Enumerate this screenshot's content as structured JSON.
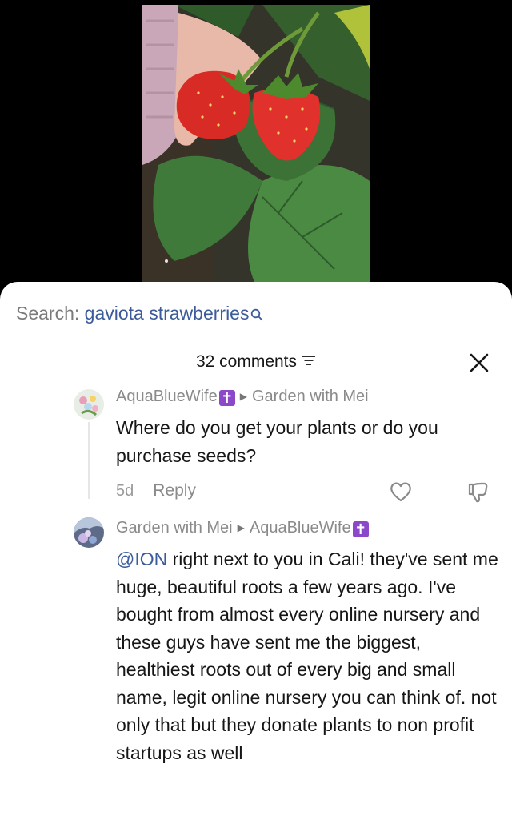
{
  "search": {
    "label": "Search:",
    "query": "gaviota strawberries",
    "icon": "search-icon"
  },
  "comments": {
    "count_label": "32 comments",
    "sort_icon": "sort-icon",
    "close_icon": "close-icon"
  },
  "comment1": {
    "author": "AquaBlueWife",
    "badge": "✝",
    "reply_to": "Garden with Mei",
    "text": "Where do you get your plants or do you purchase seeds?",
    "age": "5d",
    "reply_label": "Reply"
  },
  "comment2": {
    "author": "Garden with Mei",
    "reply_to": "AquaBlueWife",
    "badge": "✝",
    "mention": "@ION",
    "text": " right next to you in Cali! they've sent me huge, beautiful roots a few years ago. I've bought from almost every online nursery and these guys have sent me the biggest, healthiest roots out of every big and small name, legit online nursery you can think of. not only that but they donate plants to non profit startups as well"
  },
  "colors": {
    "link": "#3b5b9a",
    "badge": "#8b48c8"
  }
}
